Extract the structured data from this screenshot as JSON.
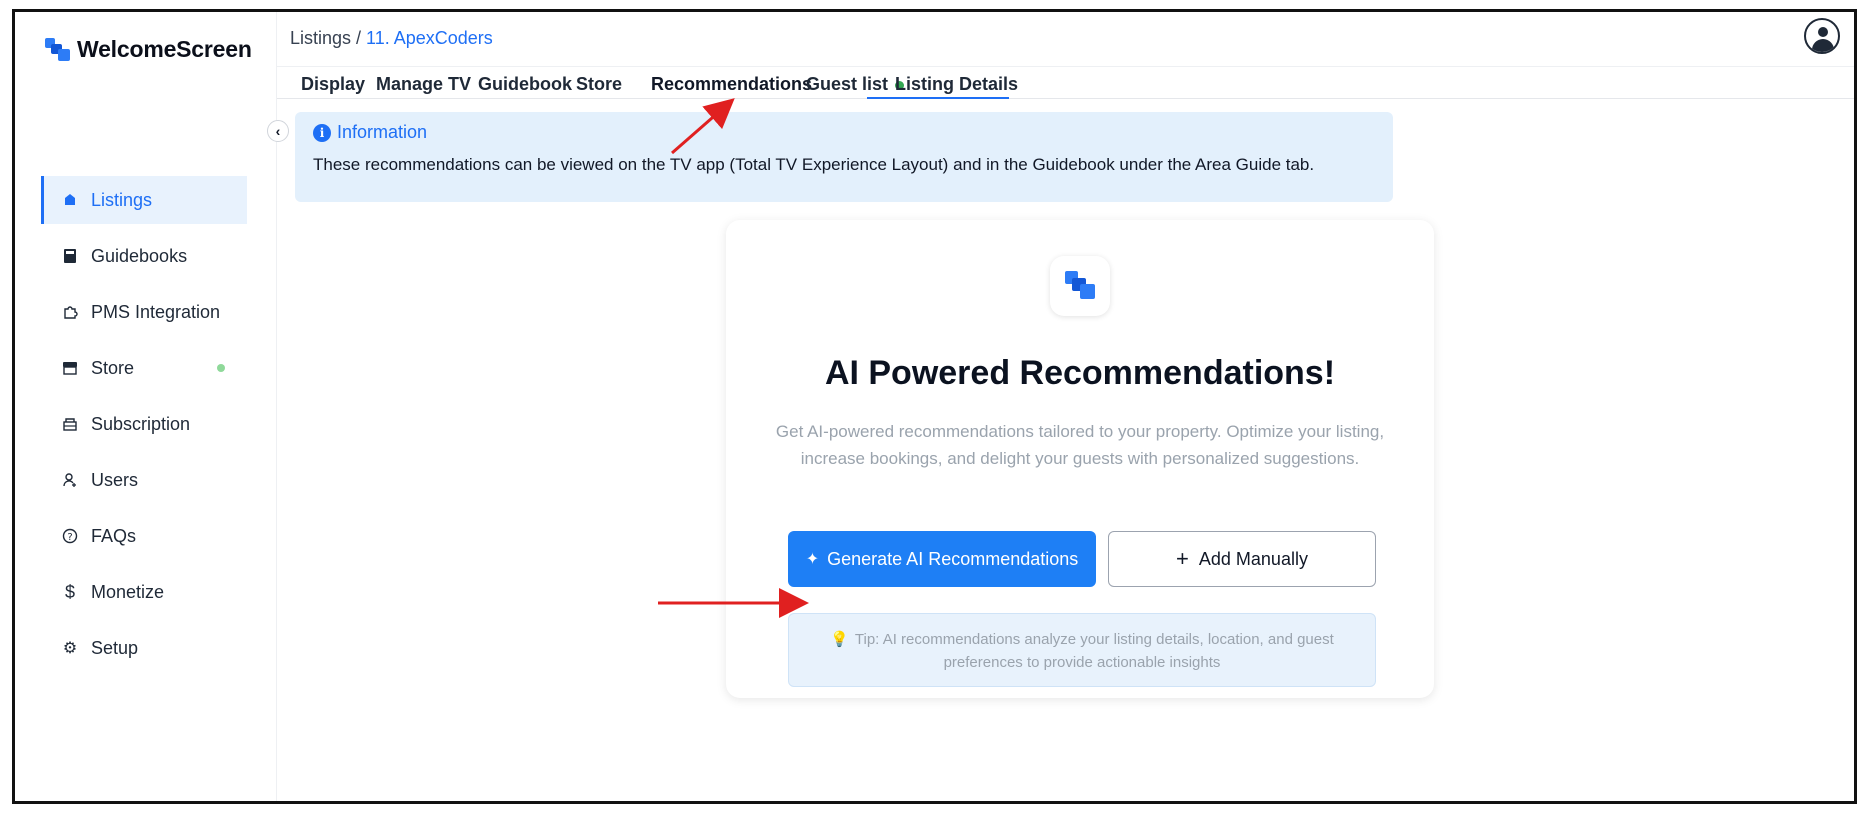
{
  "app": {
    "name": "WelcomeScreen"
  },
  "breadcrumb": {
    "root": "Listings",
    "separator": " / ",
    "current": "11. ApexCoders"
  },
  "tabs": [
    {
      "label": "Display"
    },
    {
      "label": "Manage TV"
    },
    {
      "label": "Guidebook"
    },
    {
      "label": "Store"
    },
    {
      "label": "Recommendations"
    },
    {
      "label": "Guest list"
    },
    {
      "label": "Listing Details"
    }
  ],
  "active_tab": "Recommendations",
  "sidebar": {
    "items": [
      {
        "label": "Listings",
        "icon": "listings-icon"
      },
      {
        "label": "Guidebooks",
        "icon": "book-icon"
      },
      {
        "label": "PMS Integration",
        "icon": "puzzle-icon"
      },
      {
        "label": "Store",
        "icon": "store-icon"
      },
      {
        "label": "Subscription",
        "icon": "subscription-icon"
      },
      {
        "label": "Users",
        "icon": "user-add-icon"
      },
      {
        "label": "FAQs",
        "icon": "question-icon"
      },
      {
        "label": "Monetize",
        "icon": "dollar-icon"
      },
      {
        "label": "Setup",
        "icon": "gear-icon"
      }
    ]
  },
  "info": {
    "title": "Information",
    "text": "These recommendations can be viewed on the TV app (Total TV Experience Layout) and in the Guidebook under the Area Guide tab."
  },
  "card": {
    "title": "AI Powered Recommendations!",
    "description": "Get AI-powered recommendations tailored to your property. Optimize your listing, increase bookings, and delight your guests with personalized suggestions.",
    "primary_button": "Generate AI Recommendations",
    "secondary_button": "Add Manually",
    "tip": "Tip: AI recommendations analyze your listing details, location, and guest preferences to provide actionable insights"
  },
  "colors": {
    "accent": "#1e6ff5",
    "primary_button": "#1e7ff5",
    "info_bg": "#e3f0fc",
    "status_green": "#34a853",
    "annotation_arrow": "#e02020"
  }
}
